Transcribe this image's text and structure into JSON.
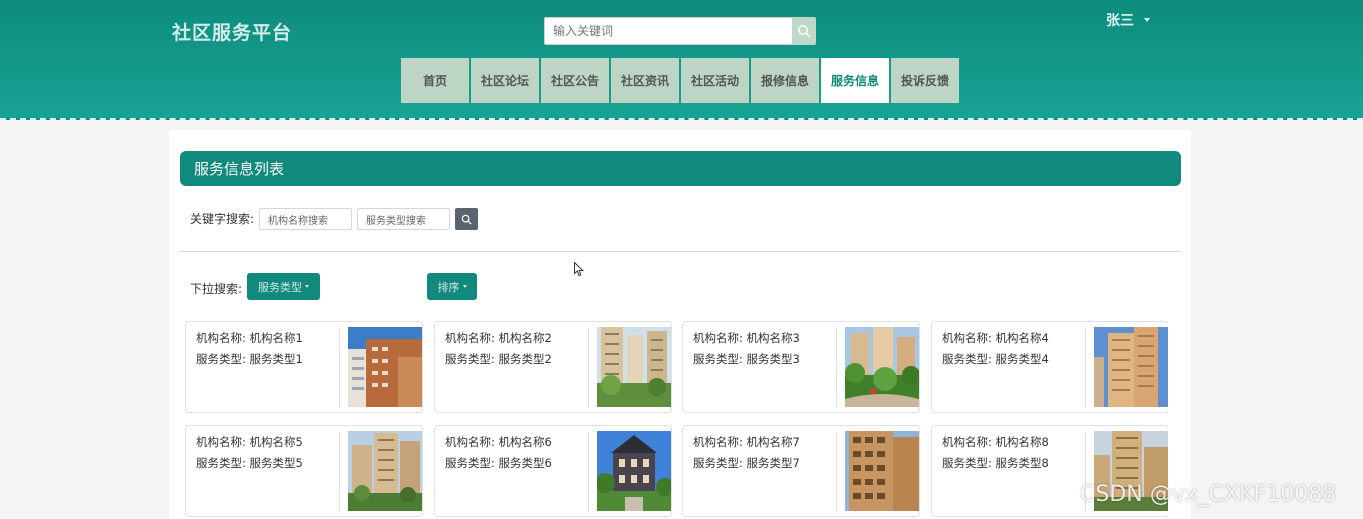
{
  "header": {
    "brand": "社区服务平台",
    "search_placeholder": "输入关键词",
    "user_name": "张三"
  },
  "nav": [
    {
      "label": "首页",
      "active": false
    },
    {
      "label": "社区论坛",
      "active": false
    },
    {
      "label": "社区公告",
      "active": false
    },
    {
      "label": "社区资讯",
      "active": false
    },
    {
      "label": "社区活动",
      "active": false
    },
    {
      "label": "报修信息",
      "active": false
    },
    {
      "label": "服务信息",
      "active": true
    },
    {
      "label": "投诉反馈",
      "active": false
    }
  ],
  "panel": {
    "title": "服务信息列表",
    "keyword_label": "关键字搜索:",
    "name_placeholder": "机构名称搜索",
    "type_placeholder": "服务类型搜索",
    "dropdown_label": "下拉搜索:",
    "type_dropdown": "服务类型",
    "sort_dropdown": "排序"
  },
  "cards": [
    {
      "name_label": "机构名称: 机构名称1",
      "type_label": "服务类型: 服务类型1",
      "image": "building-photo"
    },
    {
      "name_label": "机构名称: 机构名称2",
      "type_label": "服务类型: 服务类型2",
      "image": "building-photo"
    },
    {
      "name_label": "机构名称: 机构名称3",
      "type_label": "服务类型: 服务类型3",
      "image": "building-photo"
    },
    {
      "name_label": "机构名称: 机构名称4",
      "type_label": "服务类型: 服务类型4",
      "image": "building-photo"
    },
    {
      "name_label": "机构名称: 机构名称5",
      "type_label": "服务类型: 服务类型5",
      "image": "building-photo"
    },
    {
      "name_label": "机构名称: 机构名称6",
      "type_label": "服务类型: 服务类型6",
      "image": "building-photo"
    },
    {
      "name_label": "机构名称: 机构名称7",
      "type_label": "服务类型: 服务类型7",
      "image": "building-photo"
    },
    {
      "name_label": "机构名称: 机构名称8",
      "type_label": "服务类型: 服务类型8",
      "image": "building-photo"
    }
  ],
  "watermark": "CSDN @vx_CXKF10088",
  "colors": {
    "primary": "#11897c",
    "nav_bg": "#bcd5c4",
    "header_bg": "#17a394"
  }
}
